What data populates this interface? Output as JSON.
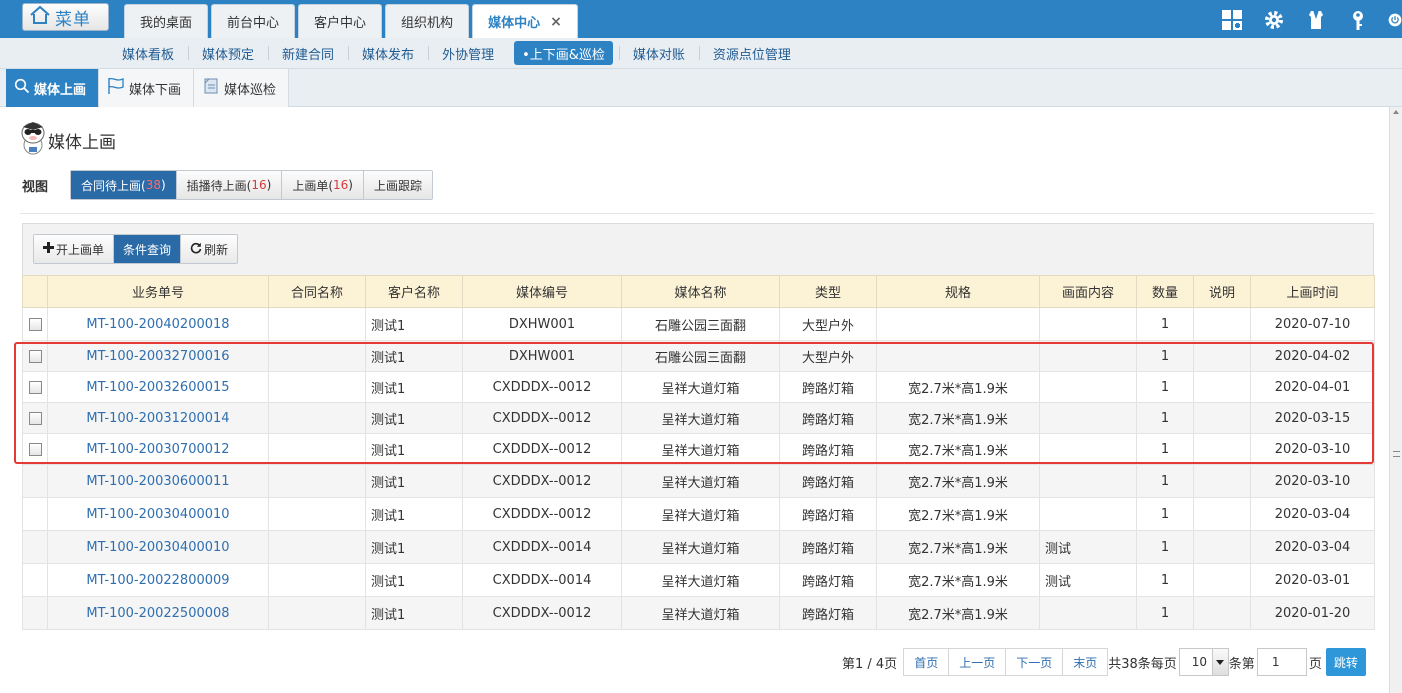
{
  "app": {
    "menu_label": "菜单",
    "tabs": [
      {
        "label": "我的桌面"
      },
      {
        "label": "前台中心"
      },
      {
        "label": "客户中心"
      },
      {
        "label": "组织机构"
      },
      {
        "label": "媒体中心",
        "active": true,
        "close": "×"
      }
    ],
    "top_icons": [
      "grid-icon",
      "gear-icon",
      "shirt-icon",
      "key-icon",
      "power-icon"
    ]
  },
  "subnav": [
    {
      "label": "媒体看板"
    },
    {
      "label": "媒体预定"
    },
    {
      "label": "新建合同"
    },
    {
      "label": "媒体发布"
    },
    {
      "label": "外协管理"
    },
    {
      "label": "•上下画&巡检",
      "active": true
    },
    {
      "label": "媒体对账"
    },
    {
      "label": "资源点位管理"
    }
  ],
  "page_tabs": [
    {
      "label": "媒体上画",
      "icon": "search-icon",
      "active": true
    },
    {
      "label": "媒体下画",
      "icon": "flag-icon"
    },
    {
      "label": "媒体巡检",
      "icon": "document-icon"
    }
  ],
  "page": {
    "title": "媒体上画",
    "view_label": "视图",
    "views": [
      {
        "label": "合同待上画(",
        "num": "38",
        "tail": ")",
        "active": true
      },
      {
        "label": "插播待上画(",
        "num": "16",
        "tail": ")"
      },
      {
        "label": "上画单(",
        "num": "16",
        "tail": ")"
      },
      {
        "label": "上画跟踪",
        "num": "",
        "tail": ""
      }
    ],
    "toolbar": {
      "open_label": "开上画单",
      "query_label": "条件查询",
      "refresh_label": "刷新"
    }
  },
  "table": {
    "columns": [
      "",
      "业务单号",
      "合同名称",
      "客户名称",
      "媒体编号",
      "媒体名称",
      "类型",
      "规格",
      "画面内容",
      "数量",
      "说明",
      "上画时间"
    ],
    "rows": [
      {
        "checkbox": true,
        "id": "MT-100-20040200018",
        "contract": "",
        "customer": "测试1",
        "media_no": "DXHW001",
        "media_name": "石雕公园三面翻",
        "type": "大型户外",
        "spec": "",
        "content": "",
        "qty": "1",
        "note": "",
        "date": "2020-07-10"
      },
      {
        "checkbox": true,
        "id": "MT-100-20032700016",
        "contract": "",
        "customer": "测试1",
        "media_no": "DXHW001",
        "media_name": "石雕公园三面翻",
        "type": "大型户外",
        "spec": "",
        "content": "",
        "qty": "1",
        "note": "",
        "date": "2020-04-02"
      },
      {
        "checkbox": true,
        "id": "MT-100-20032600015",
        "contract": "",
        "customer": "测试1",
        "media_no": "CXDDDX--0012",
        "media_name": "呈祥大道灯箱",
        "type": "跨路灯箱",
        "spec": "宽2.7米*高1.9米",
        "content": "",
        "qty": "1",
        "note": "",
        "date": "2020-04-01"
      },
      {
        "checkbox": true,
        "id": "MT-100-20031200014",
        "contract": "",
        "customer": "测试1",
        "media_no": "CXDDDX--0012",
        "media_name": "呈祥大道灯箱",
        "type": "跨路灯箱",
        "spec": "宽2.7米*高1.9米",
        "content": "",
        "qty": "1",
        "note": "",
        "date": "2020-03-15"
      },
      {
        "checkbox": true,
        "id": "MT-100-20030700012",
        "contract": "",
        "customer": "测试1",
        "media_no": "CXDDDX--0012",
        "media_name": "呈祥大道灯箱",
        "type": "跨路灯箱",
        "spec": "宽2.7米*高1.9米",
        "content": "",
        "qty": "1",
        "note": "",
        "date": "2020-03-10"
      },
      {
        "checkbox": false,
        "id": "MT-100-20030600011",
        "contract": "",
        "customer": "测试1",
        "media_no": "CXDDDX--0012",
        "media_name": "呈祥大道灯箱",
        "type": "跨路灯箱",
        "spec": "宽2.7米*高1.9米",
        "content": "",
        "qty": "1",
        "note": "",
        "date": "2020-03-10"
      },
      {
        "checkbox": false,
        "id": "MT-100-20030400010",
        "contract": "",
        "customer": "测试1",
        "media_no": "CXDDDX--0012",
        "media_name": "呈祥大道灯箱",
        "type": "跨路灯箱",
        "spec": "宽2.7米*高1.9米",
        "content": "",
        "qty": "1",
        "note": "",
        "date": "2020-03-04"
      },
      {
        "checkbox": false,
        "id": "MT-100-20030400010",
        "contract": "",
        "customer": "测试1",
        "media_no": "CXDDDX--0014",
        "media_name": "呈祥大道灯箱",
        "type": "跨路灯箱",
        "spec": "宽2.7米*高1.9米",
        "content": "测试",
        "qty": "1",
        "note": "",
        "date": "2020-03-04"
      },
      {
        "checkbox": false,
        "id": "MT-100-20022800009",
        "contract": "",
        "customer": "测试1",
        "media_no": "CXDDDX--0014",
        "media_name": "呈祥大道灯箱",
        "type": "跨路灯箱",
        "spec": "宽2.7米*高1.9米",
        "content": "测试",
        "qty": "1",
        "note": "",
        "date": "2020-03-01"
      },
      {
        "checkbox": false,
        "id": "MT-100-20022500008",
        "contract": "",
        "customer": "测试1",
        "media_no": "CXDDDX--0012",
        "media_name": "呈祥大道灯箱",
        "type": "跨路灯箱",
        "spec": "宽2.7米*高1.9米",
        "content": "",
        "qty": "1",
        "note": "",
        "date": "2020-01-20"
      }
    ]
  },
  "pager": {
    "page_info": "第1 / 4页",
    "first": "首页",
    "prev": "上一页",
    "next": "下一页",
    "last": "末页",
    "total_text": "共38条每页",
    "page_size": "10",
    "goto_prefix": "条第",
    "goto_value": "1",
    "goto_suffix": "页",
    "jump": "跳转"
  },
  "colors": {
    "accent": "#2d82c4",
    "link": "#2f6fb0",
    "header_bg": "#fcf3d7",
    "highlight": "#e53935"
  }
}
